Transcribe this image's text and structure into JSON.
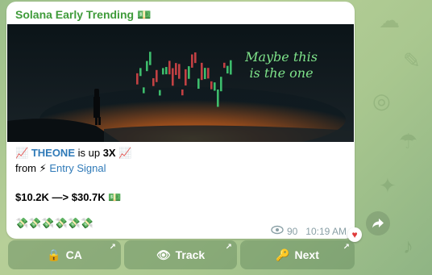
{
  "post": {
    "channel_name": "Solana Early Trending",
    "channel_emoji": "💵",
    "image_text_line1": "Maybe this",
    "image_text_line2": "is the one",
    "line1_prefix": "📈",
    "token": "THEONE",
    "line1_mid": "is up",
    "multiplier": "3X",
    "line1_suffix": "📈",
    "line2_from": "from",
    "line2_bolt": "⚡",
    "signal_link": "Entry Signal",
    "price_change": "$10.2K —> $30.7K",
    "price_emoji": "💵",
    "money_row": "💸💸💸💸💸💸",
    "views": "90",
    "time": "10:19 AM",
    "reaction": "♥"
  },
  "buttons": [
    {
      "emoji": "🔒",
      "label": "CA"
    },
    {
      "emoji": "👁",
      "label": "Track"
    },
    {
      "emoji": "🔑",
      "label": "Next"
    }
  ],
  "colors": {
    "channel_name": "#3f9b3a",
    "link": "#2f7ab8",
    "button_bg": "#6e9164",
    "heart": "#e03a3a"
  },
  "icons": {
    "views": "eye-icon",
    "share": "share-arrow-icon",
    "button_corner": "external-arrow-icon"
  }
}
